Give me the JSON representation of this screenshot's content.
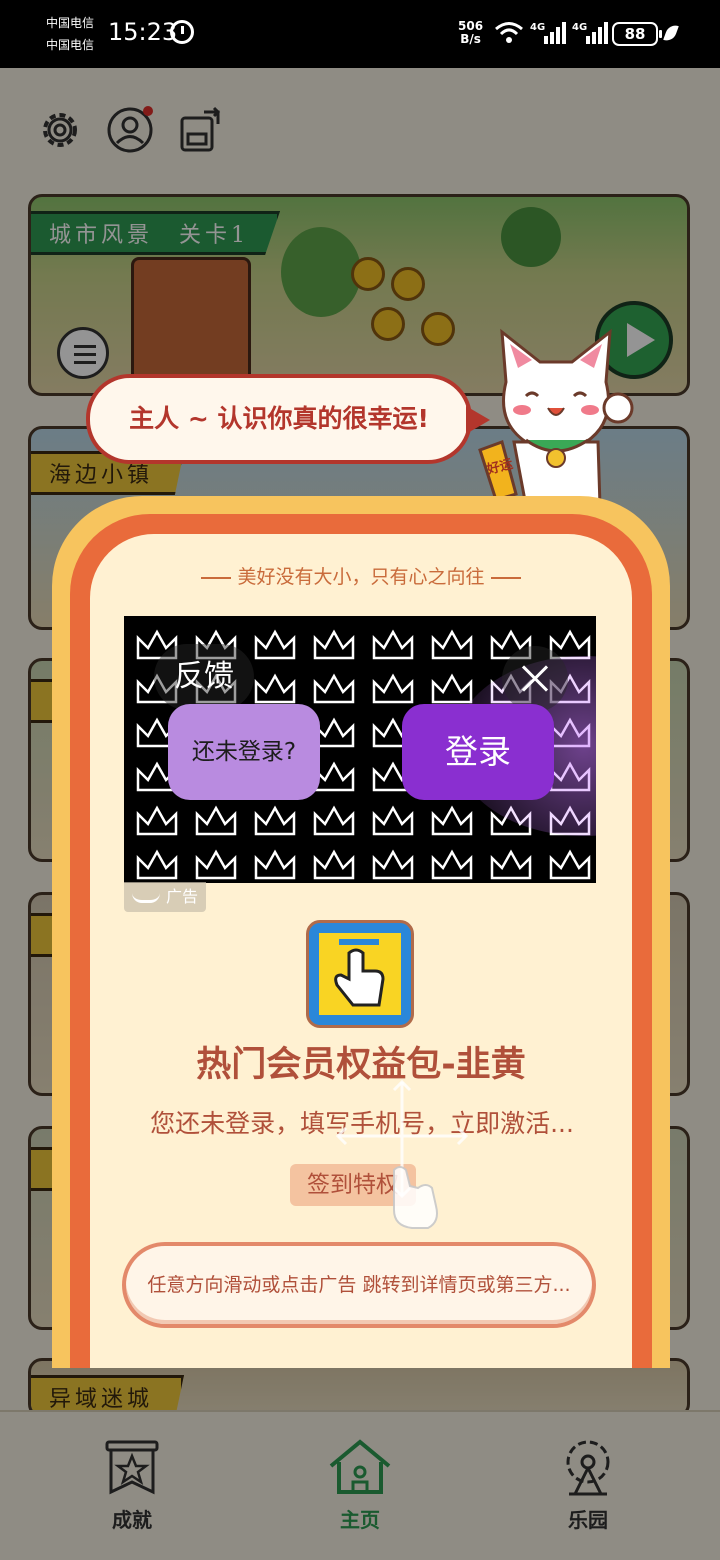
{
  "status_bar": {
    "carrier_1": "中国电信",
    "carrier_2": "中国电信",
    "time": "15:23",
    "net_speed_value": "506",
    "net_speed_unit": "B/s",
    "battery": "88"
  },
  "level_list": [
    {
      "title": "城市风景　关卡1",
      "style": "green"
    },
    {
      "title": "海边小镇",
      "style": "yellow"
    },
    {
      "title": "异域迷城",
      "style": "yellow"
    }
  ],
  "speech_bubble": {
    "text": "主人 ~ 认识你真的很幸运!"
  },
  "cat_badge": "好运",
  "popup": {
    "motto": "美好没有大小，只有心之向往",
    "ad": {
      "feedback_label": "反馈",
      "not_logged_in_label": "还未登录?",
      "login_label": "登录",
      "ad_tag": "广告"
    },
    "promo_title": "热门会员权益包-韭黄",
    "promo_desc": "您还未登录，填写手机号，立即激活...",
    "sign_in_label": "签到特权",
    "swipe_hint": "任意方向滑动或点击广告 跳转到详情页或第三方..."
  },
  "bottom_nav": [
    {
      "label": "成就",
      "icon": "achievement-banner-icon",
      "active": false
    },
    {
      "label": "主页",
      "icon": "home-icon",
      "active": true
    },
    {
      "label": "乐园",
      "icon": "ferris-wheel-icon",
      "active": false
    }
  ],
  "colors": {
    "accent_green": "#2d9b52",
    "popup_orange": "#e96b3b",
    "login_purple": "#8a2fd0"
  }
}
